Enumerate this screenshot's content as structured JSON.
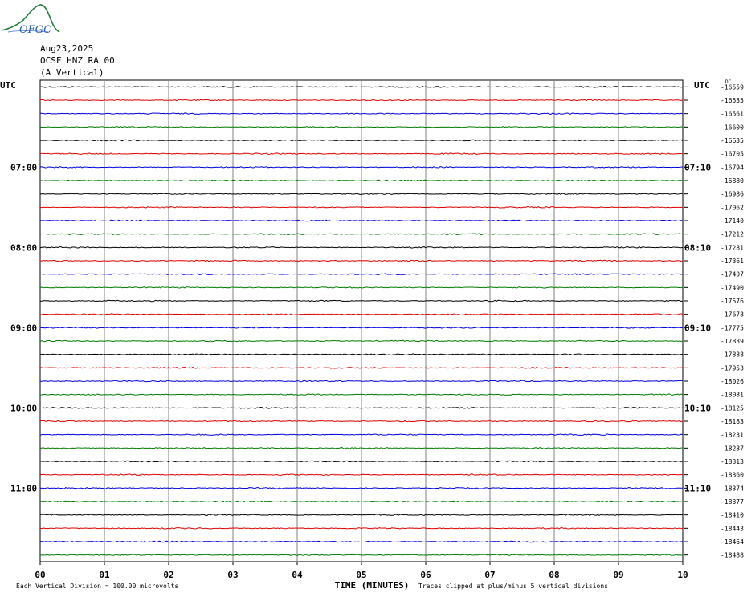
{
  "header": {
    "logo_text": "OFGC",
    "date": "Aug23,2025",
    "station": "OCSF HNZ RA 00",
    "component": "(A Vertical)"
  },
  "colors": {
    "black": "#000000",
    "red": "#e00000",
    "blue": "#0000e0",
    "green": "#007a00",
    "grid": "#808080",
    "logo": "#1f7a3a"
  },
  "chart_data": {
    "type": "line",
    "title": "",
    "left_axis_label": "UTC",
    "right_axis_label": "UTC",
    "right_top_label": "DC",
    "xlabel": "TIME (MINUTES)",
    "xlim": [
      0,
      10
    ],
    "x_ticks": [
      "00",
      "01",
      "02",
      "03",
      "04",
      "05",
      "06",
      "07",
      "08",
      "09",
      "10"
    ],
    "left_hour_labels": [
      "07:00",
      "08:00",
      "09:00",
      "10:00",
      "11:00"
    ],
    "right_hour_labels": [
      "07:10",
      "08:10",
      "09:10",
      "10:10",
      "11:10"
    ],
    "trace_color_cycle": [
      "black",
      "red",
      "blue",
      "green"
    ],
    "dc_offsets": [
      "-16559",
      "-16535",
      "-16561",
      "-16600",
      "-16635",
      "-16705",
      "-16794",
      "-16880",
      "-16986",
      "-17062",
      "-17140",
      "-17212",
      "-17281",
      "-17361",
      "-17407",
      "-17490",
      "-17576",
      "-17678",
      "-17775",
      "-17839",
      "-17888",
      "-17953",
      "-18026",
      "-18081",
      "-18125",
      "-18183",
      "-18231",
      "-18287",
      "-18313",
      "-18360",
      "-18374",
      "-18377",
      "-18410",
      "-18443",
      "-18464",
      "-18488"
    ],
    "footer_left": "Each Vertical Division =  100.00 microvolts",
    "footer_right": "Traces clipped at plus/minus 5 vertical divisions",
    "grid": true
  }
}
